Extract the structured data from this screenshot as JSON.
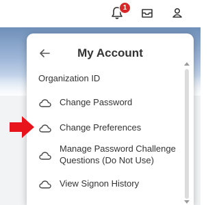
{
  "topbar": {
    "notification_count": "1",
    "icons": [
      "bell-icon",
      "inbox-icon",
      "user-icon"
    ]
  },
  "panel": {
    "title": "My Account",
    "subheading": "Organization ID",
    "back_icon": "arrow-left-icon",
    "items": [
      {
        "label": "Change Password",
        "icon": "cloud-icon"
      },
      {
        "label": "Change Preferences",
        "icon": "cloud-icon"
      },
      {
        "label": "Manage Password Challenge Questions (Do Not Use)",
        "icon": "cloud-icon"
      },
      {
        "label": "View Signon History",
        "icon": "cloud-icon"
      }
    ]
  },
  "annotation": {
    "icon": "red-arrow-icon",
    "color": "#e8141b"
  },
  "colors": {
    "badge": "#d62828",
    "text": "#333333"
  }
}
